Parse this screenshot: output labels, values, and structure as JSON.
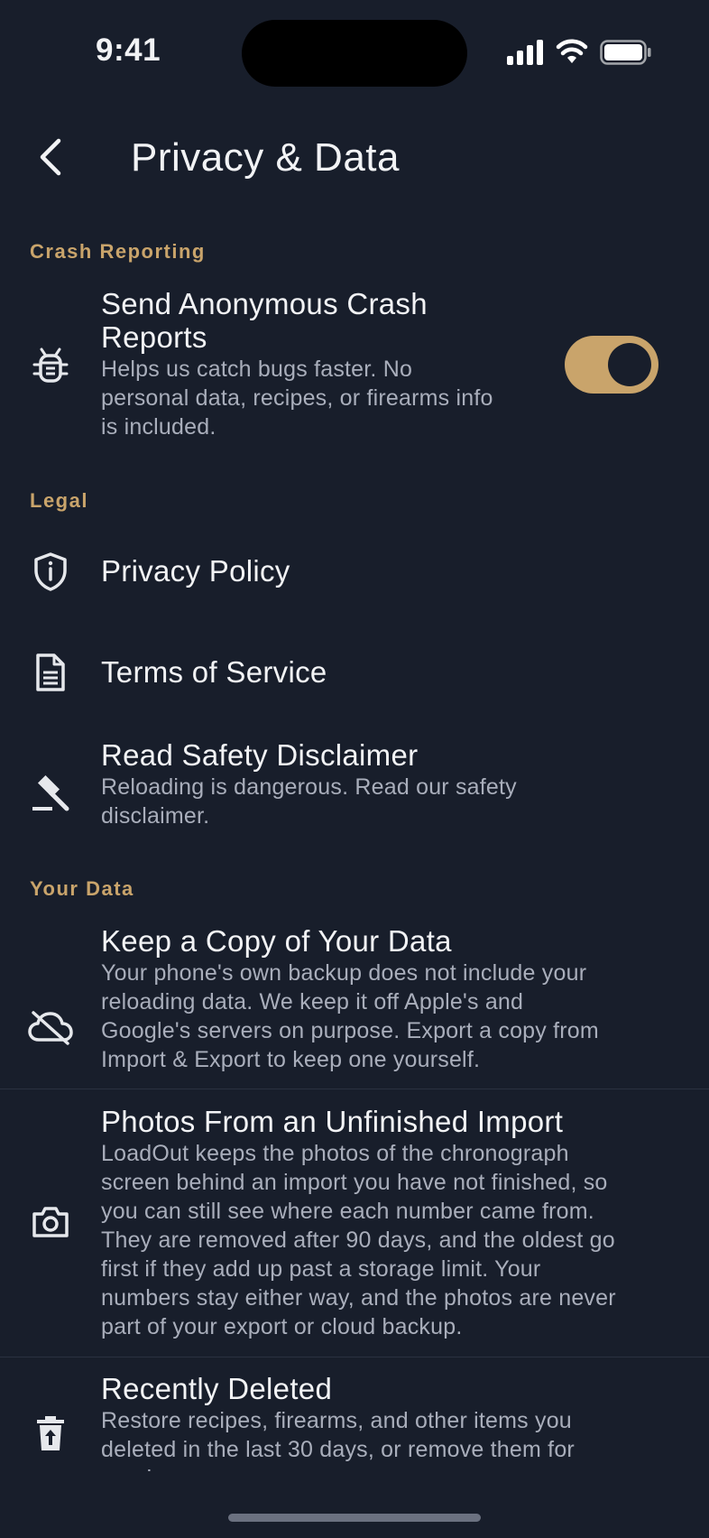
{
  "status_bar": {
    "time": "9:41"
  },
  "header": {
    "back_icon": "chevron-left-icon",
    "title": "Privacy & Data"
  },
  "sections": {
    "crash_reporting": {
      "label": "Crash Reporting",
      "send_reports": {
        "icon": "bug-icon",
        "title_line1": "Send Anonymous Crash",
        "title_line2": "Reports",
        "sub_line1": "Helps us catch bugs faster. No",
        "sub_line2": "personal data, recipes, or firearms info",
        "sub_line3": "is included.",
        "toggle_on": true
      }
    },
    "legal": {
      "label": "Legal",
      "privacy_policy": {
        "icon": "shield-info-icon",
        "title": "Privacy Policy"
      },
      "terms": {
        "icon": "document-icon",
        "title": "Terms of Service"
      },
      "disclaimer": {
        "icon": "gavel-icon",
        "title": "Read Safety Disclaimer",
        "sub_line1": "Reloading is dangerous. Read our safety",
        "sub_line2": "disclaimer."
      }
    },
    "your_data": {
      "label": "Your Data",
      "keep_copy": {
        "icon": "cloud-off-icon",
        "title": "Keep a Copy of Your Data",
        "sub_line1": "Your phone's own backup does not include your",
        "sub_line2": "reloading data. We keep it off Apple's and",
        "sub_line3": "Google's servers on purpose. Export a copy from",
        "sub_line4": "Import & Export to keep one yourself."
      },
      "photos": {
        "icon": "camera-icon",
        "title": "Photos From an Unfinished Import",
        "sub_line1": "LoadOut keeps the photos of the chronograph",
        "sub_line2": "screen behind an import you have not finished, so",
        "sub_line3": "you can still see where each number came from.",
        "sub_line4": "They are removed after 90 days, and the oldest go",
        "sub_line5": "first if they add up past a storage limit. Your",
        "sub_line6": "numbers stay either way, and the photos are never",
        "sub_line7": "part of your export or cloud backup."
      },
      "recently_deleted": {
        "icon": "trash-restore-icon",
        "title": "Recently Deleted",
        "sub_line1": "Restore recipes, firearms, and other items you",
        "sub_line2": "deleted in the last 30 days, or remove them for",
        "sub_line3": "good."
      }
    }
  },
  "colors": {
    "background": "#181e2b",
    "accent": "#c9a46b",
    "text_primary": "#f2f3f5",
    "text_secondary": "#a9aebb"
  }
}
